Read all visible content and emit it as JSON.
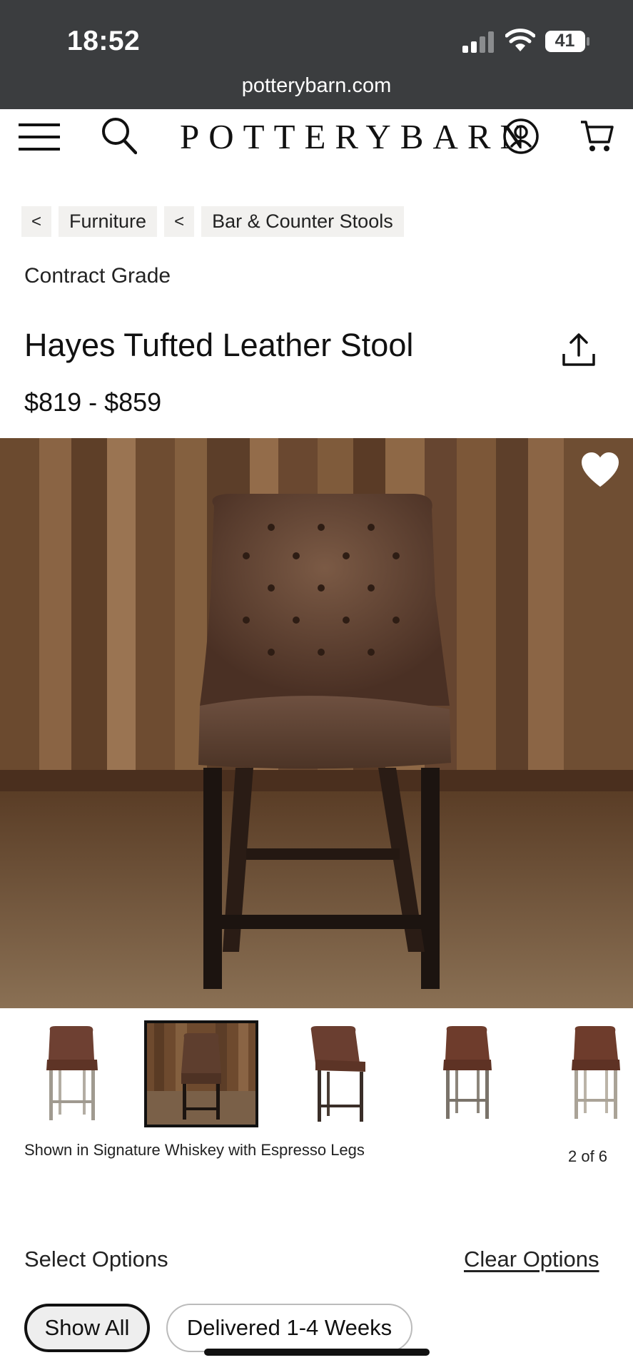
{
  "status_bar": {
    "time": "18:52",
    "battery": "41",
    "icons": [
      "signal-icon",
      "wifi-icon",
      "battery-icon"
    ]
  },
  "browser": {
    "url": "potterybarn.com"
  },
  "header": {
    "logo": "POTTERYBARN",
    "icons": [
      "menu-icon",
      "search-icon",
      "account-icon",
      "cart-icon"
    ]
  },
  "breadcrumb": {
    "items": [
      {
        "arrow": "<",
        "label": "Furniture"
      },
      {
        "arrow": "<",
        "label": "Bar & Counter Stools"
      }
    ]
  },
  "product": {
    "category": "Contract Grade",
    "title": "Hayes Tufted Leather Stool",
    "price": "$819 - $859",
    "caption": "Shown in Signature Whiskey with Espresso Legs",
    "image_counter": "2 of 6",
    "selected_thumbnail_index": 1
  },
  "options": {
    "heading": "Select Options",
    "clear_label": "Clear Options",
    "filters": [
      {
        "label": "Show All",
        "selected": true
      },
      {
        "label": "Delivered 1-4 Weeks",
        "selected": false
      }
    ]
  },
  "colors": {
    "status_bar_bg": "#3b3d3f",
    "leather": "#6a4a38",
    "espresso_legs": "#1c1410",
    "wood_wall": "#7a5434"
  }
}
